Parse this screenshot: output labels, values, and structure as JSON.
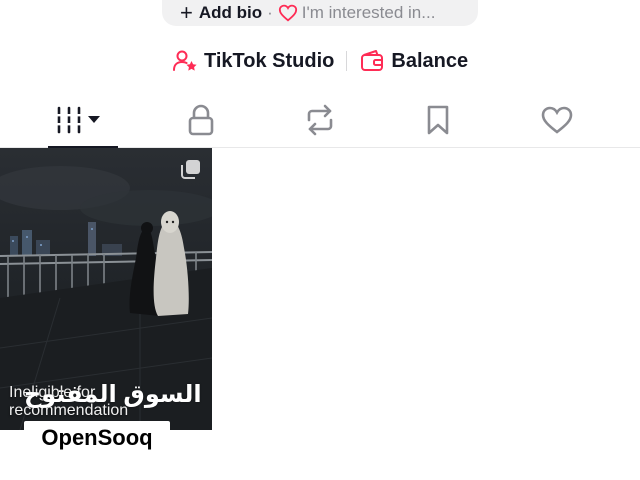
{
  "bio": {
    "add_bio_label": "Add bio",
    "separator": "·",
    "interest_label": "I'm interested in..."
  },
  "links": {
    "studio_label": "TikTok Studio",
    "balance_label": "Balance"
  },
  "tabs": [
    {
      "name": "videos",
      "icon": "grid-icon",
      "active": true
    },
    {
      "name": "private",
      "icon": "lock-icon"
    },
    {
      "name": "reposts",
      "icon": "repost-icon"
    },
    {
      "name": "favorites",
      "icon": "bookmark-icon"
    },
    {
      "name": "liked",
      "icon": "heart-icon"
    }
  ],
  "video": {
    "caption": "Ineligible for recommendation",
    "caption_line1": "Ineligible for",
    "caption_line2": "recommendation"
  },
  "watermark": {
    "arabic": "السوق المفتوح",
    "latin": "OpenSooq"
  },
  "colors": {
    "accent": "#fe2c55",
    "text": "#161823",
    "muted": "#8a8b91"
  }
}
